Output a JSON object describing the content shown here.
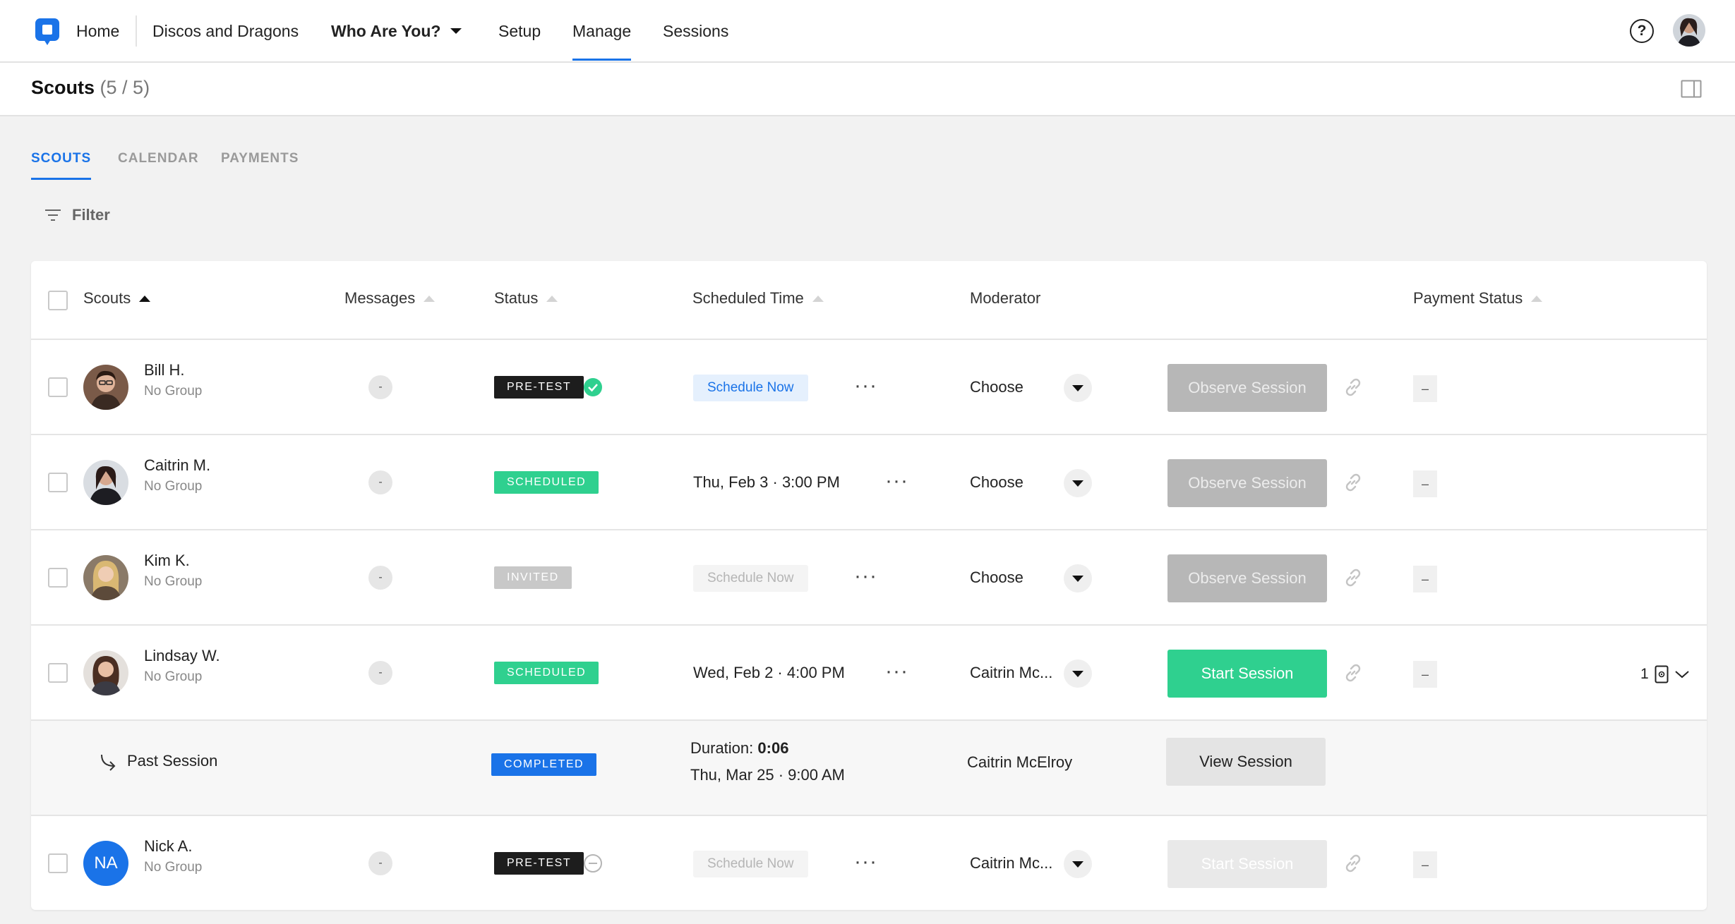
{
  "nav": {
    "home": "Home",
    "project": "Discos and Dragons",
    "study": "Who Are You?",
    "setup": "Setup",
    "manage": "Manage",
    "sessions": "Sessions",
    "help_icon": "?"
  },
  "page": {
    "title": "Scouts",
    "count": "(5 / 5)"
  },
  "tabs": [
    "SCOUTS",
    "CALENDAR",
    "PAYMENTS"
  ],
  "filter_label": "Filter",
  "columns": {
    "scouts": "Scouts",
    "messages": "Messages",
    "status": "Status",
    "scheduled_time": "Scheduled Time",
    "moderator": "Moderator",
    "payment_status": "Payment Status"
  },
  "rows": [
    {
      "name": "Bill H.",
      "group": "No Group",
      "messages": "-",
      "status": "PRE-TEST",
      "schedule": "Schedule Now",
      "moderator": "Choose",
      "action": "Observe Session",
      "payment": "–"
    },
    {
      "name": "Caitrin M.",
      "group": "No Group",
      "messages": "-",
      "status": "SCHEDULED",
      "schedule": "Thu, Feb 3 · 3:00 PM",
      "moderator": "Choose",
      "action": "Observe Session",
      "payment": "–"
    },
    {
      "name": "Kim K.",
      "group": "No Group",
      "messages": "-",
      "status": "INVITED",
      "schedule": "Schedule Now",
      "moderator": "Choose",
      "action": "Observe Session",
      "payment": "–"
    },
    {
      "name": "Lindsay W.",
      "group": "No Group",
      "messages": "-",
      "status": "SCHEDULED",
      "schedule": "Wed, Feb 2 · 4:00 PM",
      "moderator": "Caitrin Mc...",
      "action": "Start Session",
      "payment": "–",
      "session_count": "1"
    },
    {
      "name": "Nick A.",
      "initials": "NA",
      "group": "No Group",
      "messages": "-",
      "status": "PRE-TEST",
      "schedule": "Schedule Now",
      "moderator": "Caitrin Mc...",
      "action": "Start Session",
      "payment": "–"
    }
  ],
  "past_session": {
    "label": "Past Session",
    "status": "COMPLETED",
    "duration_label": "Duration:",
    "duration_value": "0:06",
    "date": "Thu, Mar 25 · 9:00 AM",
    "moderator": "Caitrin McElroy",
    "action": "View Session"
  },
  "dots": "···",
  "colors": {
    "accent": "#1a73e8",
    "scheduled": "#2fd08f",
    "pretest": "#1d1d1d",
    "invited": "#c8c8c8"
  }
}
